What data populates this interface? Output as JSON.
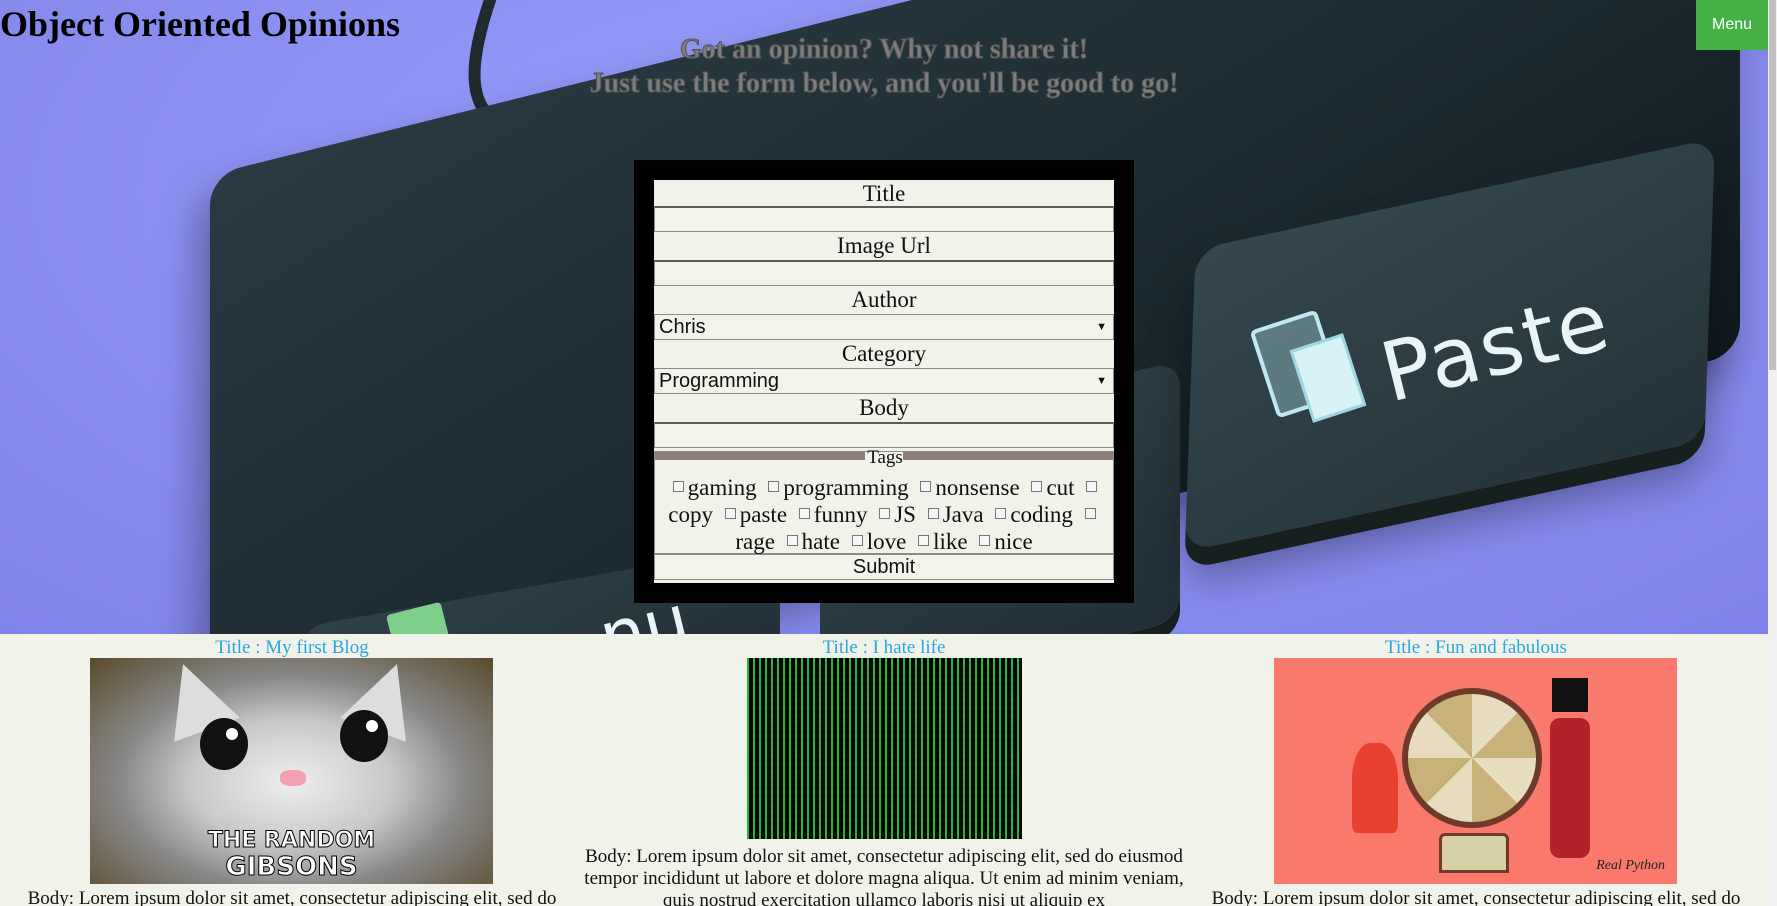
{
  "header": {
    "site_title": "Object Oriented Opinions",
    "tagline_1": "Got an opinion? Why not share it!",
    "tagline_2": "Just use the form below, and you'll be good to go!",
    "menu_label": "Menu"
  },
  "hero": {
    "paste_key": "Paste",
    "copy_key": "nu"
  },
  "form": {
    "title_label": "Title",
    "title_value": "",
    "image_url_label": "Image Url",
    "image_url_value": "",
    "author_label": "Author",
    "author_value": "Chris",
    "category_label": "Category",
    "category_value": "Programming",
    "body_label": "Body",
    "body_value": "",
    "tags_legend": "Tags",
    "tags": [
      "gaming",
      "programming",
      "nonsense",
      "cut",
      "copy",
      "paste",
      "funny",
      "JS",
      "Java",
      "coding",
      "rage",
      "hate",
      "love",
      "like",
      "nice"
    ],
    "submit_label": "Submit"
  },
  "posts": [
    {
      "title": "Title : My first Blog",
      "image_caption_1": "THE RANDOM",
      "image_caption_2": "GIBSONS",
      "body": "Body: Lorem ipsum dolor sit amet, consectetur adipiscing elit, sed do"
    },
    {
      "title": "Title : I hate life",
      "body": "Body: Lorem ipsum dolor sit amet, consectetur adipiscing elit, sed do eiusmod tempor incididunt ut labore et dolore magna aliqua. Ut enim ad minim veniam, quis nostrud exercitation ullamco laboris nisi ut aliquip ex"
    },
    {
      "title": "Title : Fun and fabulous",
      "image_signature": "Real Python",
      "body": "Body: Lorem ipsum dolor sit amet, consectetur adipiscing elit, sed do"
    }
  ],
  "colors": {
    "menu_bg": "#45b248",
    "post_title": "#2aa6e0",
    "page_bg": "#f1f3ea"
  }
}
